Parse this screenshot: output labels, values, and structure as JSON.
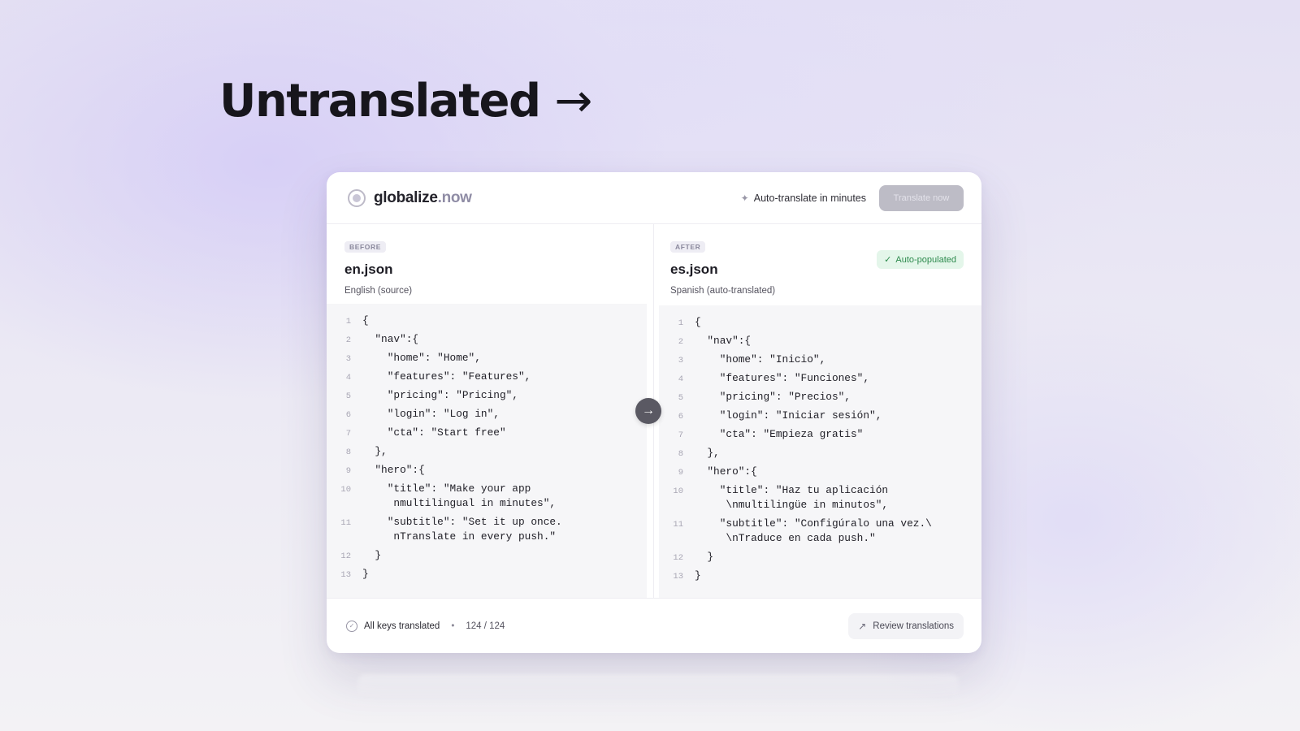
{
  "headline": {
    "text": "Untranslated",
    "arrow": "→"
  },
  "app": {
    "brand_name": "globalize",
    "brand_tld": ".now",
    "tagline": "Auto-translate in minutes",
    "translate_button": "Translate now",
    "accent_green": "#2d8a4d"
  },
  "before": {
    "tag": "BEFORE",
    "file": "en.json",
    "desc": "English (source)",
    "lines": [
      {
        "n": "1",
        "text": "{"
      },
      {
        "n": "2",
        "text": "  \"nav\":{"
      },
      {
        "n": "3",
        "text": "    \"home\": \"Home\","
      },
      {
        "n": "4",
        "text": "    \"features\": \"Features\","
      },
      {
        "n": "5",
        "text": "    \"pricing\": \"Pricing\","
      },
      {
        "n": "6",
        "text": "    \"login\": \"Log in\","
      },
      {
        "n": "7",
        "text": "    \"cta\": \"Start free\""
      },
      {
        "n": "8",
        "text": "  },"
      },
      {
        "n": "9",
        "text": "  \"hero\":{"
      },
      {
        "n": "10",
        "text": "    \"title\": \"Make your app\n     nmultilingual in minutes\","
      },
      {
        "n": "11",
        "text": "    \"subtitle\": \"Set it up once.\n     nTranslate in every push.\""
      },
      {
        "n": "12",
        "text": "  }"
      },
      {
        "n": "13",
        "text": "}"
      }
    ]
  },
  "after": {
    "tag": "AFTER",
    "file": "es.json",
    "desc": "Spanish (auto-translated)",
    "badge": "Auto-populated",
    "lines": [
      {
        "n": "1",
        "text": "{"
      },
      {
        "n": "2",
        "text": "  \"nav\":{"
      },
      {
        "n": "3",
        "text": "    \"home\": \"Inicio\","
      },
      {
        "n": "4",
        "text": "    \"features\": \"Funciones\","
      },
      {
        "n": "5",
        "text": "    \"pricing\": \"Precios\","
      },
      {
        "n": "6",
        "text": "    \"login\": \"Iniciar sesión\","
      },
      {
        "n": "7",
        "text": "    \"cta\": \"Empieza gratis\""
      },
      {
        "n": "8",
        "text": "  },"
      },
      {
        "n": "9",
        "text": "  \"hero\":{"
      },
      {
        "n": "10",
        "text": "    \"title\": \"Haz tu aplicación\n     \\nmultilingüe in minutos\","
      },
      {
        "n": "11",
        "text": "    \"subtitle\": \"Configúralo una vez.\\\n     \\nTraduce en cada push.\""
      },
      {
        "n": "12",
        "text": "  }"
      },
      {
        "n": "13",
        "text": "}"
      }
    ]
  },
  "footer": {
    "status": "All keys translated",
    "separator": "•",
    "count": "124 / 124",
    "review_button": "Review translations"
  }
}
